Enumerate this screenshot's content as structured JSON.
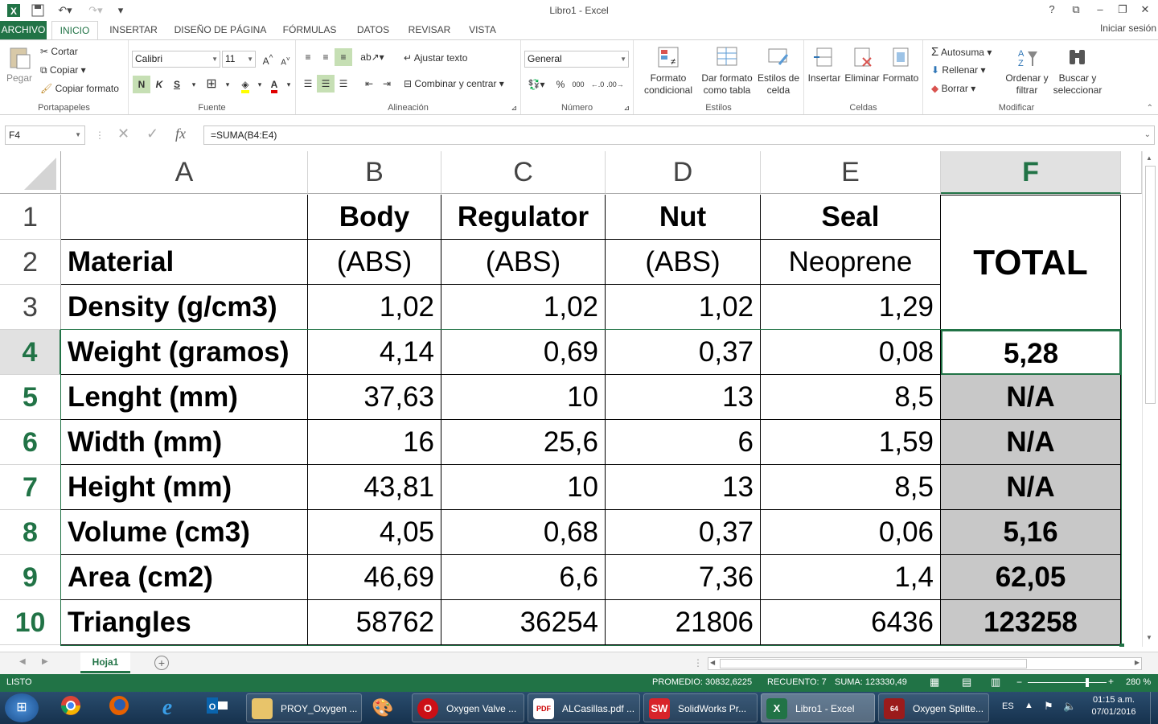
{
  "window": {
    "title": "Libro1 - Excel",
    "help": "?",
    "signin": "Iniciar sesión"
  },
  "tabs": [
    "ARCHIVO",
    "INICIO",
    "INSERTAR",
    "DISEÑO DE PÁGINA",
    "FÓRMULAS",
    "DATOS",
    "REVISAR",
    "VISTA"
  ],
  "ribbon": {
    "clipboard": {
      "paste": "Pegar",
      "cut": "Cortar",
      "copy": "Copiar",
      "format_painter": "Copiar formato",
      "label": "Portapapeles"
    },
    "font": {
      "name": "Calibri",
      "size": "11",
      "bold": "N",
      "italic": "K",
      "underline": "S",
      "label": "Fuente"
    },
    "alignment": {
      "wrap": "Ajustar texto",
      "merge": "Combinar y centrar",
      "label": "Alineación"
    },
    "number": {
      "format": "General",
      "percent": "%",
      "thousands": "000",
      "label": "Número"
    },
    "styles": {
      "conditional": "Formato condicional",
      "as_table": "Dar formato como tabla",
      "cell_styles": "Estilos de celda",
      "label": "Estilos"
    },
    "cells": {
      "insert": "Insertar",
      "delete": "Eliminar",
      "format": "Formato",
      "label": "Celdas"
    },
    "editing": {
      "autosum": "Autosuma",
      "fill": "Rellenar",
      "clear": "Borrar",
      "sort": "Ordenar y filtrar",
      "find": "Buscar y seleccionar",
      "label": "Modificar"
    }
  },
  "formula_bar": {
    "name_box": "F4",
    "fx": "fx",
    "formula": "=SUMA(B4:E4)"
  },
  "columns": [
    "A",
    "B",
    "C",
    "D",
    "E",
    "F"
  ],
  "rows": [
    "1",
    "2",
    "3",
    "4",
    "5",
    "6",
    "7",
    "8",
    "9",
    "10"
  ],
  "cells": {
    "r1": [
      "",
      "Body",
      "Regulator",
      "Nut",
      "Seal"
    ],
    "r2": [
      "Material",
      "(ABS)",
      "(ABS)",
      "(ABS)",
      "Neoprene"
    ],
    "r3": [
      "Density (g/cm3)",
      "1,02",
      "1,02",
      "1,02",
      "1,29"
    ],
    "r4": [
      "Weight (gramos)",
      "4,14",
      "0,69",
      "0,37",
      "0,08",
      "5,28"
    ],
    "r5": [
      "Lenght (mm)",
      "37,63",
      "10",
      "13",
      "8,5",
      "N/A"
    ],
    "r6": [
      "Width (mm)",
      "16",
      "25,6",
      "6",
      "1,59",
      "N/A"
    ],
    "r7": [
      "Height (mm)",
      "43,81",
      "10",
      "13",
      "8,5",
      "N/A"
    ],
    "r8": [
      "Volume (cm3)",
      "4,05",
      "0,68",
      "0,37",
      "0,06",
      "5,16"
    ],
    "r9": [
      "Area (cm2)",
      "46,69",
      "6,6",
      "7,36",
      "1,4",
      "62,05"
    ],
    "r10": [
      "Triangles",
      "58762",
      "36254",
      "21806",
      "6436",
      "123258"
    ],
    "total": "TOTAL"
  },
  "sheet_tabs": [
    "Hoja1"
  ],
  "status": {
    "mode": "LISTO",
    "average": "PROMEDIO: 30832,6225",
    "count": "RECUENTO: 7",
    "sum": "SUMA: 123330,49",
    "zoom": "280 %"
  },
  "taskbar": {
    "items": [
      "PROY_Oxygen ...",
      "Oxygen Valve ...",
      "ALCasillas.pdf ...",
      "SolidWorks Pr...",
      "Libro1 - Excel",
      "Oxygen Splitte..."
    ],
    "lang": "ES",
    "time": "01:15 a.m.",
    "date": "07/01/2016"
  }
}
